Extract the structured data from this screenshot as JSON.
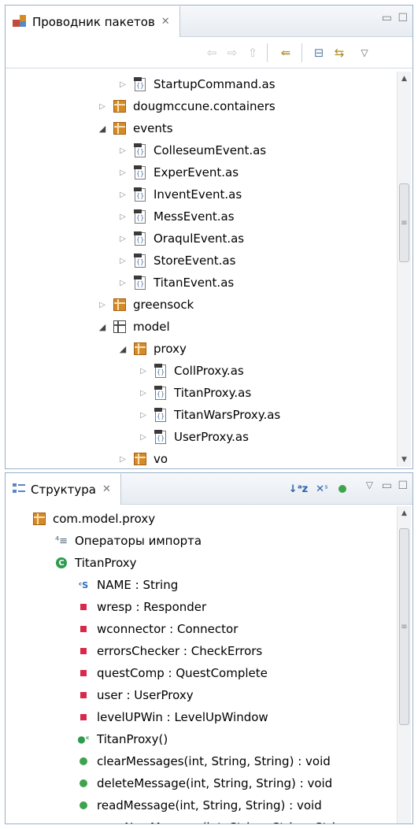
{
  "package_explorer": {
    "title": "Проводник пакетов",
    "rows": [
      {
        "indent": 2,
        "twisty": "closed",
        "icon": "file",
        "label": "StartupCommand.as"
      },
      {
        "indent": 1,
        "twisty": "closed",
        "icon": "package",
        "label": "dougmccune.containers"
      },
      {
        "indent": 1,
        "twisty": "open",
        "icon": "package",
        "label": "events"
      },
      {
        "indent": 2,
        "twisty": "closed",
        "icon": "file",
        "label": "ColleseumEvent.as"
      },
      {
        "indent": 2,
        "twisty": "closed",
        "icon": "file",
        "label": "ExperEvent.as"
      },
      {
        "indent": 2,
        "twisty": "closed",
        "icon": "file",
        "label": "InventEvent.as"
      },
      {
        "indent": 2,
        "twisty": "closed",
        "icon": "file",
        "label": "MessEvent.as"
      },
      {
        "indent": 2,
        "twisty": "closed",
        "icon": "file",
        "label": "OraqulEvent.as"
      },
      {
        "indent": 2,
        "twisty": "closed",
        "icon": "file",
        "label": "StoreEvent.as"
      },
      {
        "indent": 2,
        "twisty": "closed",
        "icon": "file",
        "label": "TitanEvent.as"
      },
      {
        "indent": 1,
        "twisty": "closed",
        "icon": "package",
        "label": "greensock"
      },
      {
        "indent": 1,
        "twisty": "open",
        "icon": "package-empty",
        "label": "model"
      },
      {
        "indent": 2,
        "twisty": "open",
        "icon": "package",
        "label": "proxy"
      },
      {
        "indent": 3,
        "twisty": "closed",
        "icon": "file",
        "label": "CollProxy.as"
      },
      {
        "indent": 3,
        "twisty": "closed",
        "icon": "file",
        "label": "TitanProxy.as"
      },
      {
        "indent": 3,
        "twisty": "closed",
        "icon": "file",
        "label": "TitanWarsProxy.as"
      },
      {
        "indent": 3,
        "twisty": "closed",
        "icon": "file",
        "label": "UserProxy.as"
      },
      {
        "indent": 2,
        "twisty": "closed",
        "icon": "package",
        "label": "vo"
      }
    ]
  },
  "outline": {
    "title": "Структура",
    "rows": [
      {
        "indent": 0,
        "icon": "package",
        "label": "com.model.proxy"
      },
      {
        "indent": 1,
        "icon": "imports",
        "label": "Операторы импорта"
      },
      {
        "indent": 1,
        "icon": "class",
        "label": "TitanProxy"
      },
      {
        "indent": 2,
        "icon": "constant",
        "label": "NAME : String"
      },
      {
        "indent": 2,
        "icon": "private",
        "label": "wresp : Responder"
      },
      {
        "indent": 2,
        "icon": "private",
        "label": "wconnector : Connector"
      },
      {
        "indent": 2,
        "icon": "private",
        "label": "errorsChecker : CheckErrors"
      },
      {
        "indent": 2,
        "icon": "private",
        "label": "questComp : QuestComplete"
      },
      {
        "indent": 2,
        "icon": "private",
        "label": "user : UserProxy"
      },
      {
        "indent": 2,
        "icon": "private",
        "label": "levelUPWin : LevelUpWindow"
      },
      {
        "indent": 2,
        "icon": "constructor",
        "label": "TitanProxy()"
      },
      {
        "indent": 2,
        "icon": "public",
        "label": "clearMessages(int, String, String) : void"
      },
      {
        "indent": 2,
        "icon": "public",
        "label": "deleteMessage(int, String, String) : void"
      },
      {
        "indent": 2,
        "icon": "public",
        "label": "readMessage(int, String, String) : void"
      },
      {
        "indent": 2,
        "icon": "public",
        "label": "saveNewMessage(int, String, String, String, :"
      }
    ]
  },
  "colors": {
    "accent": "#d58a28",
    "public": "#3fa34d",
    "private": "#d62a4b"
  }
}
